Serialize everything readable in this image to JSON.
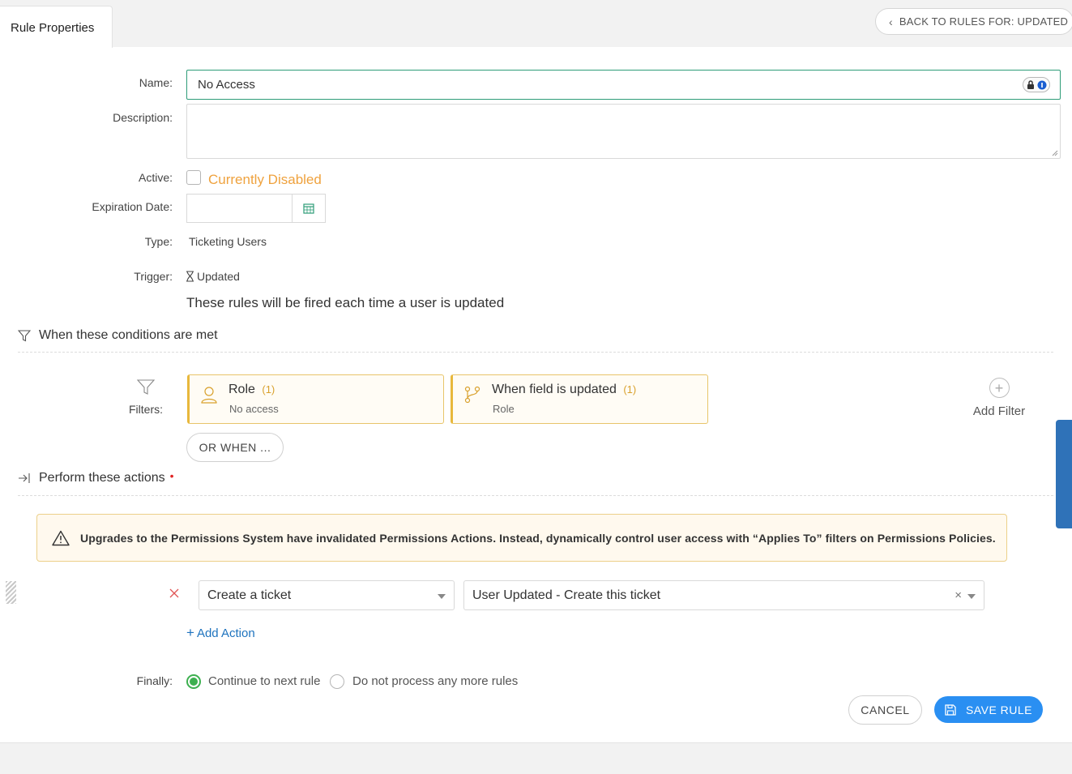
{
  "header": {
    "tab_label": "Rule Properties",
    "back_button_label": "BACK TO RULES FOR: UPDATED"
  },
  "form": {
    "name_label": "Name:",
    "name_value": "No Access",
    "description_label": "Description:",
    "description_value": "",
    "active_label": "Active:",
    "active_checked": false,
    "active_status": "Currently Disabled",
    "expiration_label": "Expiration Date:",
    "expiration_value": "",
    "type_label": "Type:",
    "type_value": "Ticketing Users",
    "trigger_label": "Trigger:",
    "trigger_value": "Updated",
    "trigger_description": "These rules will be fired each time a user is updated"
  },
  "conditions": {
    "heading": "When these conditions are met",
    "filters_label": "Filters:",
    "filters": [
      {
        "title": "Role",
        "count": "(1)",
        "sub": "No access",
        "icon": "user-icon"
      },
      {
        "title": "When field is updated",
        "count": "(1)",
        "sub": "Role",
        "icon": "branch-icon"
      }
    ],
    "or_when_label": "OR WHEN ...",
    "add_filter_label": "Add Filter"
  },
  "actions": {
    "heading": "Perform these actions",
    "required_marker": "•",
    "warning_text": "Upgrades to the Permissions System have invalidated Permissions Actions. Instead, dynamically control user access with “Applies To” filters on Permissions Policies.",
    "action_type": "Create a ticket",
    "action_value": "User Updated - Create this ticket",
    "add_action_label": "Add Action"
  },
  "finally": {
    "label": "Finally:",
    "option_continue": "Continue to next rule",
    "option_stop": "Do not process any more rules",
    "selected": "continue"
  },
  "buttons": {
    "cancel_label": "CANCEL",
    "save_label": "SAVE RULE"
  },
  "colors": {
    "accent_green": "#2e9c78",
    "warning_orange": "#efa23e",
    "primary_blue": "#2a8ff2",
    "filter_border": "#e8b83c"
  }
}
